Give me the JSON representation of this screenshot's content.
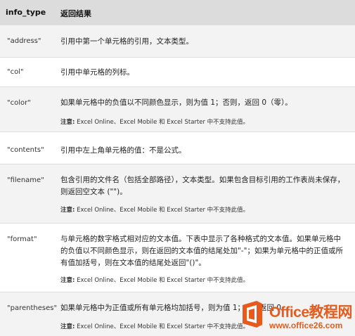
{
  "headers": {
    "col1": "info_type",
    "col2": "返回结果"
  },
  "note_prefix": "注意:",
  "rows": [
    {
      "key": "\"address\"",
      "desc": "引用中第一个单元格的引用，文本类型。"
    },
    {
      "key": "\"col\"",
      "desc": "引用中单元格的列标。"
    },
    {
      "key": "\"color\"",
      "desc": "如果单元格中的负值以不同颜色显示，则为值 1；否则，返回 0（零）。",
      "note": "Excel Online、Excel Mobile 和 Excel Starter 中不支持此值。"
    },
    {
      "key": "\"contents\"",
      "desc": "引用中左上角单元格的值：不是公式。"
    },
    {
      "key": "\"filename\"",
      "desc": "包含引用的文件名（包括全部路径），文本类型。如果包含目标引用的工作表尚未保存，则返回空文本 (\"\")。",
      "note": "Excel Online、Excel Mobile 和 Excel Starter 中不支持此值。"
    },
    {
      "key": "\"format\"",
      "desc": "与单元格的数字格式相对应的文本值。下表中显示了各种格式的文本值。如果单元格中的负值以不同颜色显示，则在返回的文本值的结尾处加\"-\"；如果为单元格中的正值或所有值加括号，则在文本值的结尾处返回\"()\"。",
      "note": "Excel Online、Excel Mobile 和 Excel Starter 中不支持此值。"
    },
    {
      "key": "\"parentheses\"",
      "desc": "如果单元格中为正值或所有单元格均加括号，则为值 1；否则返回 0。",
      "note": "Excel Online、Excel Mobile 和 Excel Starter 中不支持此值。"
    }
  ],
  "watermark": {
    "title": "Office教程网",
    "url": "www.office26.com"
  },
  "colors": {
    "header_bg": "#dcdcdc",
    "alt_row": "#f3f3f3",
    "brand": "#e25d1f"
  }
}
